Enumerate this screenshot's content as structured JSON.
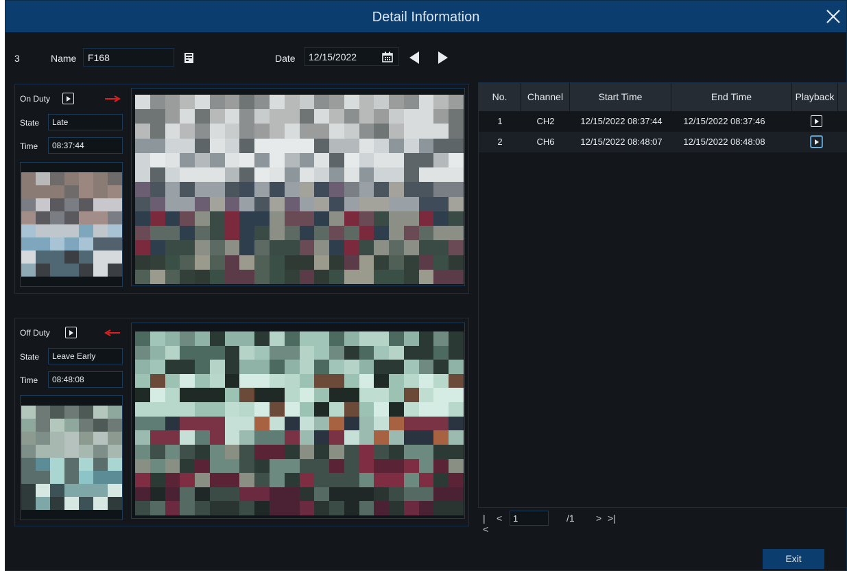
{
  "window": {
    "title": "Detail Information"
  },
  "header": {
    "index": "3",
    "name_label": "Name",
    "name_value": "F168",
    "date_label": "Date",
    "date_value": "12/15/2022"
  },
  "on_duty": {
    "label": "On Duty",
    "state_label": "State",
    "state_value": "Late",
    "time_label": "Time",
    "time_value": "08:37:44"
  },
  "off_duty": {
    "label": "Off Duty",
    "state_label": "State",
    "state_value": "Leave Early",
    "time_label": "Time",
    "time_value": "08:48:08"
  },
  "table": {
    "columns": [
      "No.",
      "Channel",
      "Start Time",
      "End Time",
      "Playback"
    ],
    "rows": [
      {
        "no": "1",
        "channel": "CH2",
        "start": "12/15/2022 08:37:44",
        "end": "12/15/2022 08:37:46"
      },
      {
        "no": "2",
        "channel": "CH6",
        "start": "12/15/2022 08:48:07",
        "end": "12/15/2022 08:48:08"
      }
    ]
  },
  "pager": {
    "first": "|<",
    "prev": "<",
    "page": "1",
    "total": "/1",
    "next": ">",
    "last": ">|"
  },
  "footer": {
    "exit_label": "Exit"
  },
  "colors": {
    "accent": "#0b3e6e",
    "arrow": "#e02020",
    "border": "#14304d",
    "background": "#13171b"
  }
}
